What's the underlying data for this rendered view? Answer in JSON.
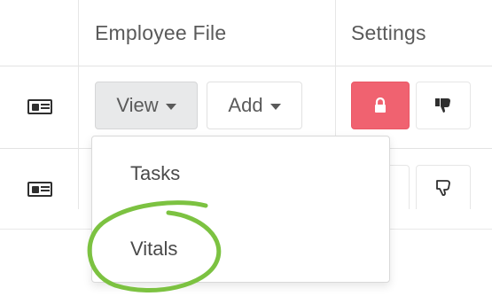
{
  "table": {
    "headers": {
      "employee_file": "Employee File",
      "settings": "Settings"
    }
  },
  "row1": {
    "view_label": "View",
    "add_label": "Add",
    "lock_icon": "lock-icon",
    "thumb_icon": "thumbs-down-icon"
  },
  "row2": {
    "thumb_icon": "thumbs-down-outline-icon"
  },
  "dropdown": {
    "items": [
      "Tasks",
      "Vitals"
    ]
  },
  "colors": {
    "lock_button": "#f06270",
    "highlight_circle": "#7cc241",
    "view_button_bg": "#e8e9ea"
  }
}
